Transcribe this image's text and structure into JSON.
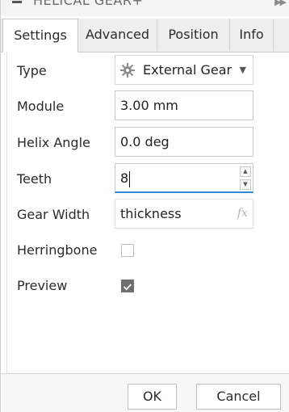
{
  "title_bar": {
    "title": "HELICAL GEAR",
    "collapse_icon": "minus-icon",
    "expand_icon": "double-chevron-right-icon"
  },
  "tabs": [
    {
      "label": "Settings",
      "active": true
    },
    {
      "label": "Advanced",
      "active": false
    },
    {
      "label": "Position",
      "active": false
    },
    {
      "label": "Info",
      "active": false
    }
  ],
  "form": {
    "type": {
      "label": "Type",
      "value": "External Gear",
      "icon": "gear-icon"
    },
    "module": {
      "label": "Module",
      "value": "3.00 mm"
    },
    "helix_angle": {
      "label": "Helix Angle",
      "value": "0.0 deg"
    },
    "teeth": {
      "label": "Teeth",
      "value": "8"
    },
    "gear_width": {
      "label": "Gear Width",
      "value": "thickness",
      "expression_hint": "fx"
    },
    "herringbone": {
      "label": "Herringbone",
      "checked": false
    },
    "preview": {
      "label": "Preview",
      "checked": true
    }
  },
  "footer": {
    "ok_label": "OK",
    "cancel_label": "Cancel"
  },
  "colors": {
    "accent": "#2e86d6",
    "checkbox_checked": "#6f6f6f"
  }
}
